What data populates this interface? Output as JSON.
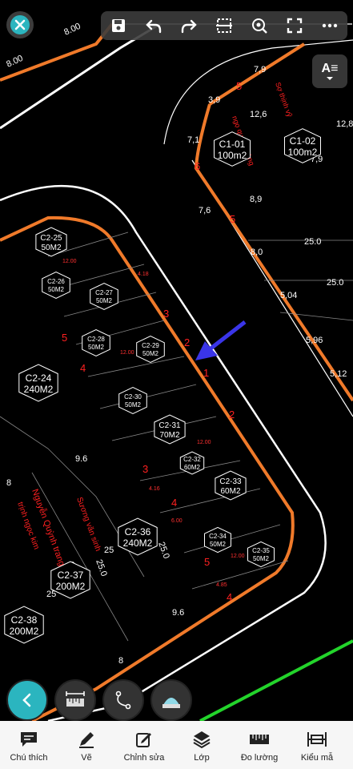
{
  "toolbar": {
    "close_icon": "close-icon",
    "tools": [
      "save-icon",
      "undo-icon",
      "redo-icon",
      "compare-icon",
      "zoom-icon",
      "fullscreen-icon",
      "more-icon"
    ],
    "text_toggle_label": "A≡"
  },
  "map": {
    "road_width_labels": [
      "8.00",
      "8.00",
      "8.0",
      "9.6",
      "25.0",
      "25.0",
      "25.0",
      "25.0",
      "25.0",
      "25",
      "25",
      "9.6",
      "8",
      "8"
    ],
    "plots": [
      {
        "id": "C2-25",
        "area": "50M2"
      },
      {
        "id": "C2-26",
        "area": "50M2"
      },
      {
        "id": "C2-27",
        "area": "50M2"
      },
      {
        "id": "C2-28",
        "area": "50M2"
      },
      {
        "id": "C2-29",
        "area": "50M2"
      },
      {
        "id": "C2-24",
        "area": "240M2"
      },
      {
        "id": "C2-30",
        "area": "50M2"
      },
      {
        "id": "C2-31",
        "area": "70M2"
      },
      {
        "id": "C2-32",
        "area": "60M2"
      },
      {
        "id": "C2-33",
        "area": "60M2"
      },
      {
        "id": "C2-36",
        "area": "240M2"
      },
      {
        "id": "C2-34",
        "area": "50M2"
      },
      {
        "id": "C2-35",
        "area": "50M2"
      },
      {
        "id": "C2-37",
        "area": "200M2"
      },
      {
        "id": "C2-38",
        "area": "200M2"
      },
      {
        "id": "C1-01",
        "area": "100m2"
      },
      {
        "id": "C1-02",
        "area": "100m2"
      }
    ],
    "dims": [
      "7,9",
      "3,9",
      "12,6",
      "12,8",
      "7,1",
      "7,6",
      "8,9",
      "7,9",
      "8,0",
      "5,04",
      "5,96",
      "5,12",
      "12.00",
      "4.16",
      "4.18",
      "6.00",
      "4.85"
    ],
    "side_numbers": [
      "2",
      "3",
      "1",
      "2",
      "3",
      "4",
      "5",
      "5",
      "6",
      "5",
      "4",
      "3",
      "5",
      "4"
    ],
    "street_names": [
      "Nguyễn Quỳnh trang",
      "Sương văn sinh",
      "trịnh ngọc kim",
      "ngọ quang hùng",
      "Sợ thịnh vỹ"
    ]
  },
  "fabs": {
    "back_label": "back",
    "tools": [
      "ruler-icon",
      "path-icon",
      "area-icon"
    ]
  },
  "bottom_nav": [
    {
      "label": "Chú thích",
      "icon": "comment-icon"
    },
    {
      "label": "Vẽ",
      "icon": "pen-icon"
    },
    {
      "label": "Chỉnh sửa",
      "icon": "edit-icon"
    },
    {
      "label": "Lớp",
      "icon": "layers-icon"
    },
    {
      "label": "Đo lường",
      "icon": "measure-icon"
    },
    {
      "label": "Kiểu mẫ",
      "icon": "style-icon"
    }
  ],
  "colors": {
    "background": "#000000",
    "parcel_line": "#f07a2a",
    "road_line": "#ffffff",
    "label_red": "#ff2020",
    "arrow": "#3a35e8",
    "accent": "#2bb5bf",
    "green_line": "#23d42b"
  }
}
